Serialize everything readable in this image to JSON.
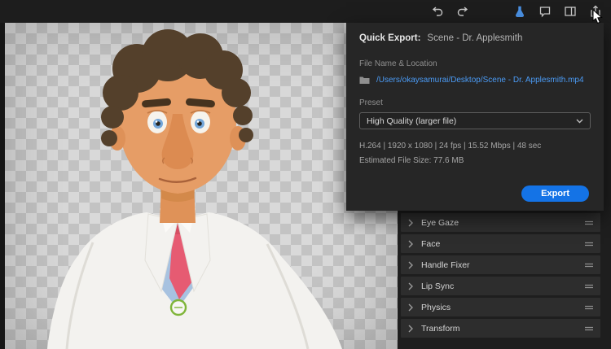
{
  "toolbar": {
    "icons": [
      "undo-icon",
      "redo-icon",
      "flask-icon",
      "comment-icon",
      "workspace-icon",
      "share-icon"
    ]
  },
  "quick_export": {
    "title": "Quick Export:",
    "scene": "Scene - Dr. Applesmith",
    "file_label": "File Name & Location",
    "file_path": "/Users/okaysamurai/Desktop/Scene - Dr. Applesmith.mp4",
    "preset_label": "Preset",
    "preset_value": "High Quality (larger file)",
    "specs": "H.264 | 1920 x 1080 | 24 fps | 15.52 Mbps | 48 sec",
    "estimated_size": "Estimated File Size: 77.6 MB",
    "export_label": "Export",
    "accent_color": "#1473e6",
    "link_color": "#4b9bf5"
  },
  "properties": {
    "items": [
      {
        "label": "Eye Gaze"
      },
      {
        "label": "Face"
      },
      {
        "label": "Handle Fixer"
      },
      {
        "label": "Lip Sync"
      },
      {
        "label": "Physics"
      },
      {
        "label": "Transform"
      }
    ]
  }
}
